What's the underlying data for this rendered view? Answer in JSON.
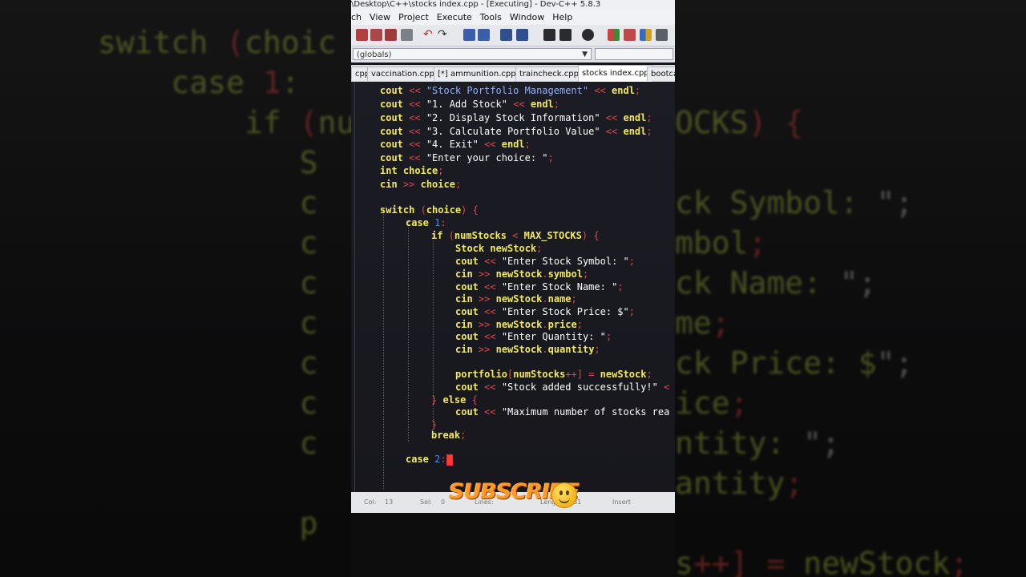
{
  "window": {
    "title": "\\Desktop\\C++\\stocks index.cpp - [Executing] - Dev-C++ 5.8.3"
  },
  "menu": [
    "ch",
    "View",
    "Project",
    "Execute",
    "Tools",
    "Window",
    "Help"
  ],
  "scope_selector": {
    "value": "(globals)"
  },
  "tabs": [
    {
      "label": "cpp",
      "active": false
    },
    {
      "label": "vaccination.cpp",
      "active": false
    },
    {
      "label": "[*] ammunition.cpp",
      "active": false
    },
    {
      "label": "traincheck.cpp",
      "active": false
    },
    {
      "label": "stocks index.cpp",
      "active": true
    },
    {
      "label": "bootca",
      "active": false
    }
  ],
  "code_lines": [
    {
      "indent": 0,
      "tokens": [
        [
          "k",
          "cout "
        ],
        [
          "o",
          "<< "
        ],
        [
          "s",
          "\"Stock Portfolio Management\" "
        ],
        [
          "o",
          "<< "
        ],
        [
          "k",
          "endl"
        ],
        [
          "o",
          ";"
        ]
      ]
    },
    {
      "indent": 0,
      "tokens": [
        [
          "k",
          "cout "
        ],
        [
          "o",
          "<< "
        ],
        [
          "s2",
          "\"1. Add Stock\" "
        ],
        [
          "o",
          "<< "
        ],
        [
          "k",
          "endl"
        ],
        [
          "o",
          ";"
        ]
      ]
    },
    {
      "indent": 0,
      "tokens": [
        [
          "k",
          "cout "
        ],
        [
          "o",
          "<< "
        ],
        [
          "s2",
          "\"2. Display Stock Information\" "
        ],
        [
          "o",
          "<< "
        ],
        [
          "k",
          "endl"
        ],
        [
          "o",
          ";"
        ]
      ]
    },
    {
      "indent": 0,
      "tokens": [
        [
          "k",
          "cout "
        ],
        [
          "o",
          "<< "
        ],
        [
          "s2",
          "\"3. Calculate Portfolio Value\" "
        ],
        [
          "o",
          "<< "
        ],
        [
          "k",
          "endl"
        ],
        [
          "o",
          ";"
        ]
      ]
    },
    {
      "indent": 0,
      "tokens": [
        [
          "k",
          "cout "
        ],
        [
          "o",
          "<< "
        ],
        [
          "s2",
          "\"4. Exit\" "
        ],
        [
          "o",
          "<< "
        ],
        [
          "k",
          "endl"
        ],
        [
          "o",
          ";"
        ]
      ]
    },
    {
      "indent": 0,
      "tokens": [
        [
          "k",
          "cout "
        ],
        [
          "o",
          "<< "
        ],
        [
          "s2",
          "\"Enter your choice: \""
        ],
        [
          "o",
          ";"
        ]
      ]
    },
    {
      "indent": 0,
      "tokens": [
        [
          "k",
          "int choice"
        ],
        [
          "o",
          ";"
        ]
      ]
    },
    {
      "indent": 0,
      "tokens": [
        [
          "k",
          "cin "
        ],
        [
          "o",
          ">> "
        ],
        [
          "k",
          "choice"
        ],
        [
          "o",
          ";"
        ]
      ]
    },
    {
      "indent": 0,
      "tokens": []
    },
    {
      "indent": 0,
      "tokens": [
        [
          "k",
          "switch "
        ],
        [
          "o",
          "("
        ],
        [
          "k",
          "choice"
        ],
        [
          "o",
          ") {"
        ]
      ]
    },
    {
      "indent": 1,
      "tokens": [
        [
          "k",
          "case "
        ],
        [
          "n",
          "1"
        ],
        [
          "o",
          ":"
        ]
      ]
    },
    {
      "indent": 2,
      "tokens": [
        [
          "k",
          "if "
        ],
        [
          "o",
          "("
        ],
        [
          "k",
          "numStocks "
        ],
        [
          "o",
          "< "
        ],
        [
          "k",
          "MAX_STOCKS"
        ],
        [
          "o",
          ") {"
        ]
      ]
    },
    {
      "indent": 3,
      "tokens": [
        [
          "k",
          "Stock newStock"
        ],
        [
          "o",
          ";"
        ]
      ]
    },
    {
      "indent": 3,
      "tokens": [
        [
          "k",
          "cout "
        ],
        [
          "o",
          "<< "
        ],
        [
          "s2",
          "\"Enter Stock Symbol: \""
        ],
        [
          "o",
          ";"
        ]
      ]
    },
    {
      "indent": 3,
      "tokens": [
        [
          "k",
          "cin "
        ],
        [
          "o",
          ">> "
        ],
        [
          "k",
          "newStock"
        ],
        [
          "o",
          "."
        ],
        [
          "k",
          "symbol"
        ],
        [
          "o",
          ";"
        ]
      ]
    },
    {
      "indent": 3,
      "tokens": [
        [
          "k",
          "cout "
        ],
        [
          "o",
          "<< "
        ],
        [
          "s2",
          "\"Enter Stock Name: \""
        ],
        [
          "o",
          ";"
        ]
      ]
    },
    {
      "indent": 3,
      "tokens": [
        [
          "k",
          "cin "
        ],
        [
          "o",
          ">> "
        ],
        [
          "k",
          "newStock"
        ],
        [
          "o",
          "."
        ],
        [
          "k",
          "name"
        ],
        [
          "o",
          ";"
        ]
      ]
    },
    {
      "indent": 3,
      "tokens": [
        [
          "k",
          "cout "
        ],
        [
          "o",
          "<< "
        ],
        [
          "s2",
          "\"Enter Stock Price: $\""
        ],
        [
          "o",
          ";"
        ]
      ]
    },
    {
      "indent": 3,
      "tokens": [
        [
          "k",
          "cin "
        ],
        [
          "o",
          ">> "
        ],
        [
          "k",
          "newStock"
        ],
        [
          "o",
          "."
        ],
        [
          "k",
          "price"
        ],
        [
          "o",
          ";"
        ]
      ]
    },
    {
      "indent": 3,
      "tokens": [
        [
          "k",
          "cout "
        ],
        [
          "o",
          "<< "
        ],
        [
          "s2",
          "\"Enter Quantity: \""
        ],
        [
          "o",
          ";"
        ]
      ]
    },
    {
      "indent": 3,
      "tokens": [
        [
          "k",
          "cin "
        ],
        [
          "o",
          ">> "
        ],
        [
          "k",
          "newStock"
        ],
        [
          "o",
          "."
        ],
        [
          "k",
          "quantity"
        ],
        [
          "o",
          ";"
        ]
      ]
    },
    {
      "indent": 3,
      "tokens": []
    },
    {
      "indent": 3,
      "tokens": [
        [
          "k",
          "portfolio"
        ],
        [
          "o",
          "["
        ],
        [
          "k",
          "numStocks"
        ],
        [
          "o",
          "++] = "
        ],
        [
          "k",
          "newStock"
        ],
        [
          "o",
          ";"
        ]
      ]
    },
    {
      "indent": 3,
      "tokens": [
        [
          "k",
          "cout "
        ],
        [
          "o",
          "<< "
        ],
        [
          "s2",
          "\"Stock added successfully!\" "
        ],
        [
          "o",
          "<"
        ]
      ]
    },
    {
      "indent": 2,
      "tokens": [
        [
          "o",
          "} "
        ],
        [
          "k",
          "else "
        ],
        [
          "o",
          "{"
        ]
      ]
    },
    {
      "indent": 3,
      "tokens": [
        [
          "k",
          "cout "
        ],
        [
          "o",
          "<< "
        ],
        [
          "s2",
          "\"Maximum number of stocks rea"
        ]
      ]
    },
    {
      "indent": 2,
      "tokens": [
        [
          "o",
          "}"
        ]
      ]
    },
    {
      "indent": 2,
      "tokens": [
        [
          "k",
          "break"
        ],
        [
          "o",
          ";"
        ]
      ]
    },
    {
      "indent": 1,
      "tokens": []
    },
    {
      "indent": 1,
      "tokens": [
        [
          "k",
          "case "
        ],
        [
          "n",
          "2"
        ],
        [
          "o",
          ":"
        ],
        [
          "cursor",
          ""
        ]
      ]
    }
  ],
  "statusbar": {
    "col_label": "Col:",
    "col_value": "13",
    "sel_label": "Sel:",
    "sel_value": "0",
    "lines_label": "Lines:",
    "length_label": "Length:",
    "length_value": "381",
    "mode": "Insert"
  },
  "overlay": {
    "subscribe_text": "SUBSCRIBE"
  },
  "background_blur": {
    "left_lines": [
      "switch (choic",
      "    case 1:",
      "        if (nu",
      "           S",
      "           c",
      "           c",
      "           c",
      "           c",
      "           c",
      "           c",
      "           c",
      "",
      "           p"
    ],
    "right_lines": [
      "OCKS) {",
      "",
      "ck Symbol: \";",
      "mbol;",
      "ck Name: \";",
      "me;",
      "ck Price: $\";",
      "ice;",
      "ntity: \";",
      "antity;",
      "",
      "s++] = newStock;"
    ]
  }
}
